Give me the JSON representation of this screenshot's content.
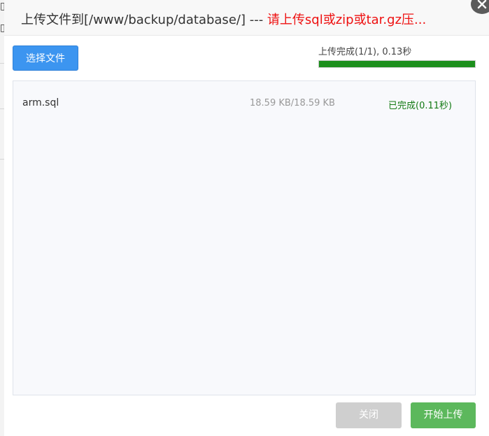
{
  "dialog": {
    "title_path": "上传文件到[/www/backup/database/] --- ",
    "title_warning": "请上传sql或zip或tar.gz压..."
  },
  "toolbar": {
    "choose_label": "选择文件"
  },
  "progress": {
    "text": "上传完成(1/1), 0.13秒",
    "fraction": 1.0
  },
  "files": [
    {
      "name": "arm.sql",
      "size": "18.59 KB/18.59 KB",
      "status": "已完成(0.11秒)"
    }
  ],
  "buttons": {
    "close_label": "关闭",
    "start_label": "开始上传"
  },
  "colors": {
    "accent": "#3c95f0",
    "success": "#1c8f1c",
    "warning": "#e11111"
  },
  "icons": {
    "close": "close-icon"
  }
}
